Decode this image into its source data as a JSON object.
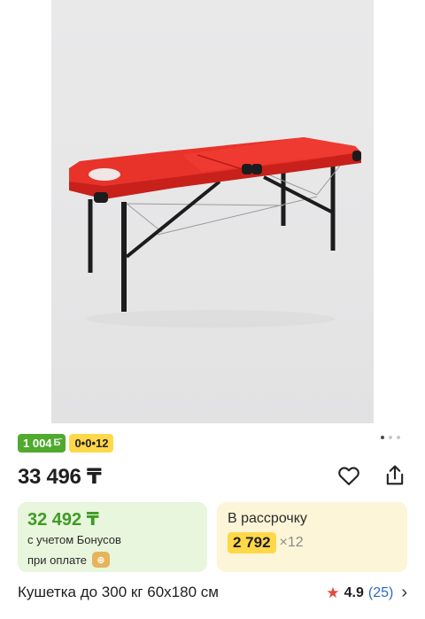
{
  "product": {
    "image_alt": "red folding massage table",
    "carousel": {
      "count": 3,
      "active": 0
    },
    "badges": {
      "bonus_amount": "1 004",
      "bonus_icon": "bonus-icon",
      "installment_code": "0•0•12"
    },
    "price": "33 496 ₸",
    "bonus_card": {
      "price": "32 492 ₸",
      "line1": "с учетом Бонусов",
      "line2": "при оплате",
      "payment_icon": "kaspi-pay-icon"
    },
    "installment_card": {
      "label": "В рассрочку",
      "amount": "2 792",
      "times": "×12"
    },
    "title": "Кушетка до 300 кг 60х180 см",
    "rating": {
      "value": "4.9",
      "count": "(25)"
    }
  },
  "colors": {
    "accent_green": "#4faa2e",
    "accent_yellow": "#ffd84a",
    "star": "#e24a3b",
    "link": "#2e69c9"
  }
}
